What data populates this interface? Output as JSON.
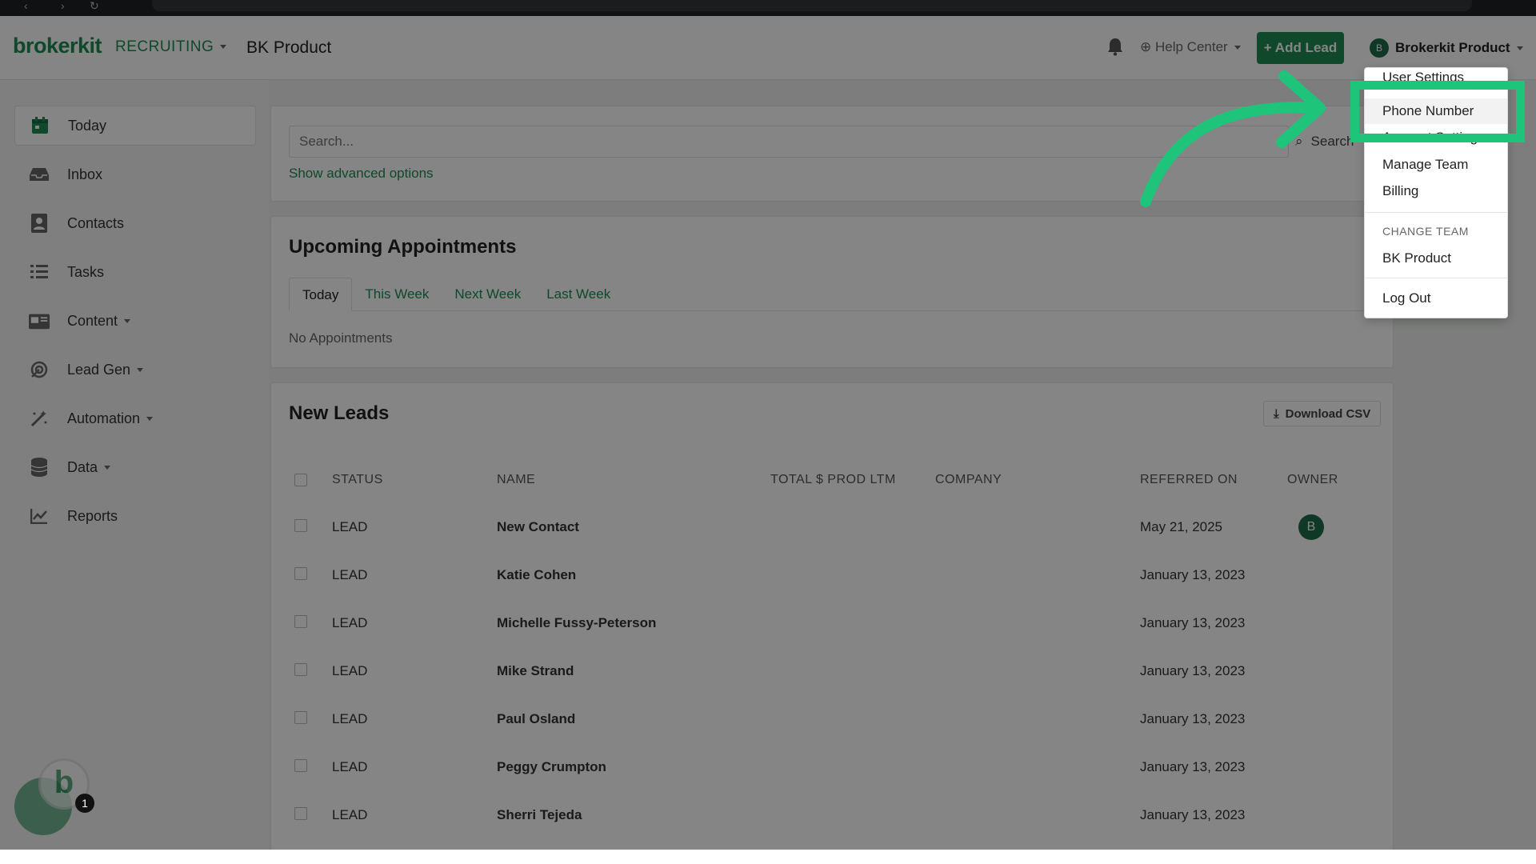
{
  "browser": {
    "back": "‹",
    "forward": "›",
    "reload": "↻"
  },
  "header": {
    "logo": "brokerkit",
    "module": "RECRUITING",
    "team_title": "BK Product",
    "help_center": "Help Center",
    "add_lead": "+ Add Lead",
    "user_name": "Brokerkit Product",
    "user_initial": "B"
  },
  "sidebar": {
    "items": [
      {
        "label": "Today",
        "icon": "calendar-icon"
      },
      {
        "label": "Inbox",
        "icon": "inbox-icon"
      },
      {
        "label": "Contacts",
        "icon": "contacts-icon"
      },
      {
        "label": "Tasks",
        "icon": "tasks-icon"
      },
      {
        "label": "Content",
        "icon": "content-icon"
      },
      {
        "label": "Lead Gen",
        "icon": "lead-gen-icon"
      },
      {
        "label": "Automation",
        "icon": "automation-icon"
      },
      {
        "label": "Data",
        "icon": "database-icon"
      },
      {
        "label": "Reports",
        "icon": "chart-icon"
      }
    ]
  },
  "search": {
    "placeholder": "Search...",
    "button": "Search",
    "advanced": "Show advanced options"
  },
  "appointments": {
    "title": "Upcoming Appointments",
    "tabs": [
      "Today",
      "This Week",
      "Next Week",
      "Last Week"
    ],
    "empty": "No Appointments"
  },
  "leads": {
    "title": "New Leads",
    "download": "Download CSV",
    "columns": [
      "STATUS",
      "NAME",
      "TOTAL $ PROD LTM",
      "COMPANY",
      "REFERRED ON",
      "OWNER"
    ],
    "rows": [
      {
        "status": "LEAD",
        "name": "New Contact",
        "referred": "May 21, 2025",
        "owner": "B"
      },
      {
        "status": "LEAD",
        "name": "Katie Cohen",
        "referred": "January 13, 2023",
        "owner": ""
      },
      {
        "status": "LEAD",
        "name": "Michelle Fussy-Peterson",
        "referred": "January 13, 2023",
        "owner": ""
      },
      {
        "status": "LEAD",
        "name": "Mike Strand",
        "referred": "January 13, 2023",
        "owner": ""
      },
      {
        "status": "LEAD",
        "name": "Paul Osland",
        "referred": "January 13, 2023",
        "owner": ""
      },
      {
        "status": "LEAD",
        "name": "Peggy Crumpton",
        "referred": "January 13, 2023",
        "owner": ""
      },
      {
        "status": "LEAD",
        "name": "Sherri Tejeda",
        "referred": "January 13, 2023",
        "owner": ""
      }
    ]
  },
  "user_dropdown": {
    "user_settings": "User Settings",
    "phone_number": "Phone Number",
    "account_settings": "Account Settings",
    "manage_team": "Manage Team",
    "billing": "Billing",
    "change_team_header": "CHANGE TEAM",
    "team": "BK Product",
    "logout": "Log Out"
  },
  "chat": {
    "logo": "b",
    "badge": "1"
  },
  "colors": {
    "brand_green": "#1e8a52",
    "highlight": "#1ec47a"
  }
}
